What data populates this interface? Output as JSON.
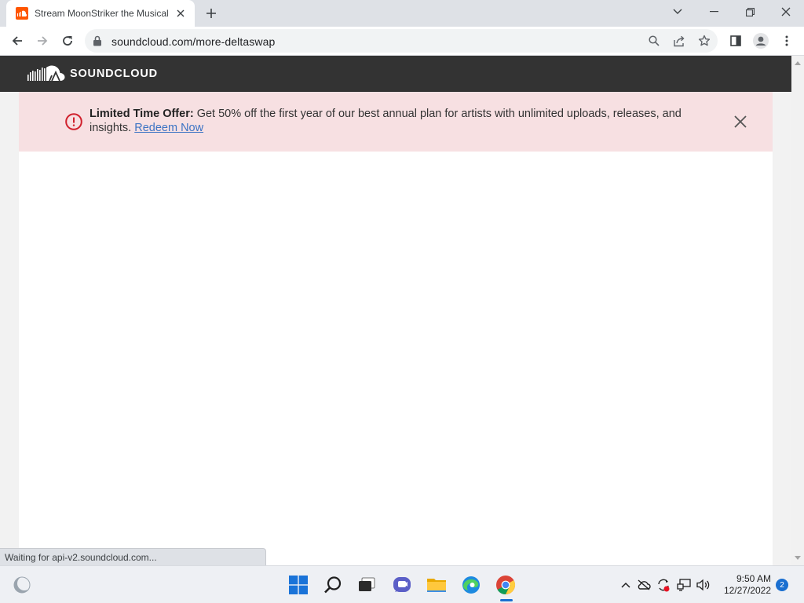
{
  "browser": {
    "tab_title": "Stream MoonStriker the Musical",
    "url": "soundcloud.com/more-deltaswap",
    "status_text": "Waiting for api-v2.soundcloud.com..."
  },
  "page": {
    "brand": "SOUNDCLOUD",
    "banner": {
      "lead": "Limited Time Offer:",
      "text": " Get 50% off the first year of our best annual plan for artists with unlimited uploads, releases, and insights. ",
      "link": "Redeem Now"
    }
  },
  "taskbar": {
    "time": "9:50 AM",
    "date": "12/27/2022",
    "notifications": "2"
  },
  "colors": {
    "soundcloud_orange": "#ff5500",
    "header_bg": "#333333",
    "banner_bg": "#f7e0e2",
    "alert_red": "#d0202c",
    "link_blue": "#3d74c4"
  }
}
